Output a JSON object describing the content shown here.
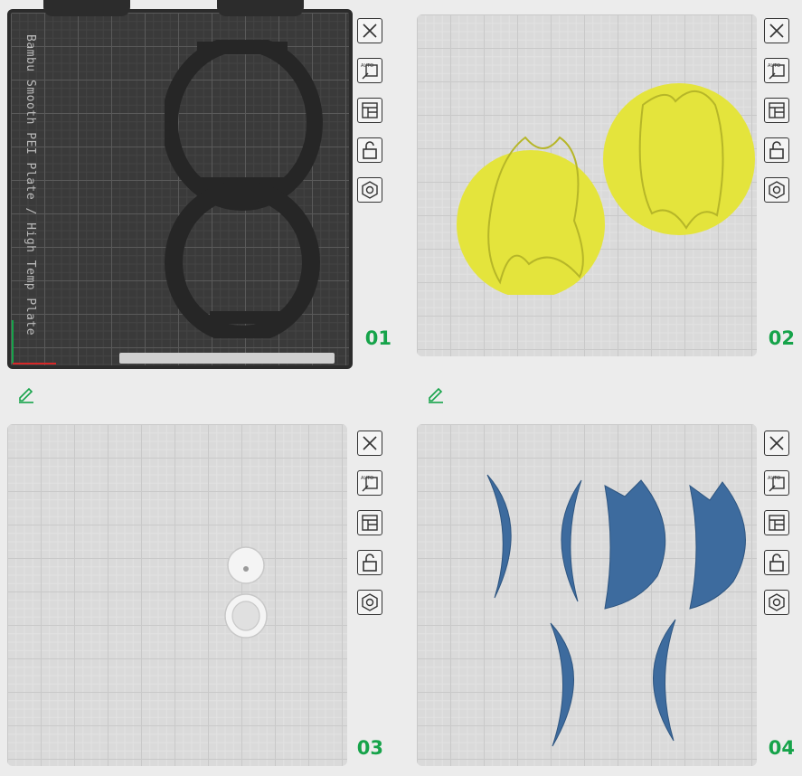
{
  "plates": [
    {
      "label": "01",
      "name": "Bambu Smooth PEI Plate / High Temp Plate",
      "theme": "dark"
    },
    {
      "label": "02",
      "theme": "light"
    },
    {
      "label": "03",
      "theme": "light"
    },
    {
      "label": "04",
      "theme": "light"
    }
  ],
  "tools": [
    "close-icon",
    "auto-arrange-icon",
    "layout-icon",
    "lock-icon",
    "settings-nut-icon"
  ],
  "colors": {
    "label_green": "#16a34a",
    "object_black": "#2e2e2e",
    "object_yellow": "#e4e43c",
    "object_blue": "#3d6b9e",
    "object_white": "#f2f2f2"
  }
}
